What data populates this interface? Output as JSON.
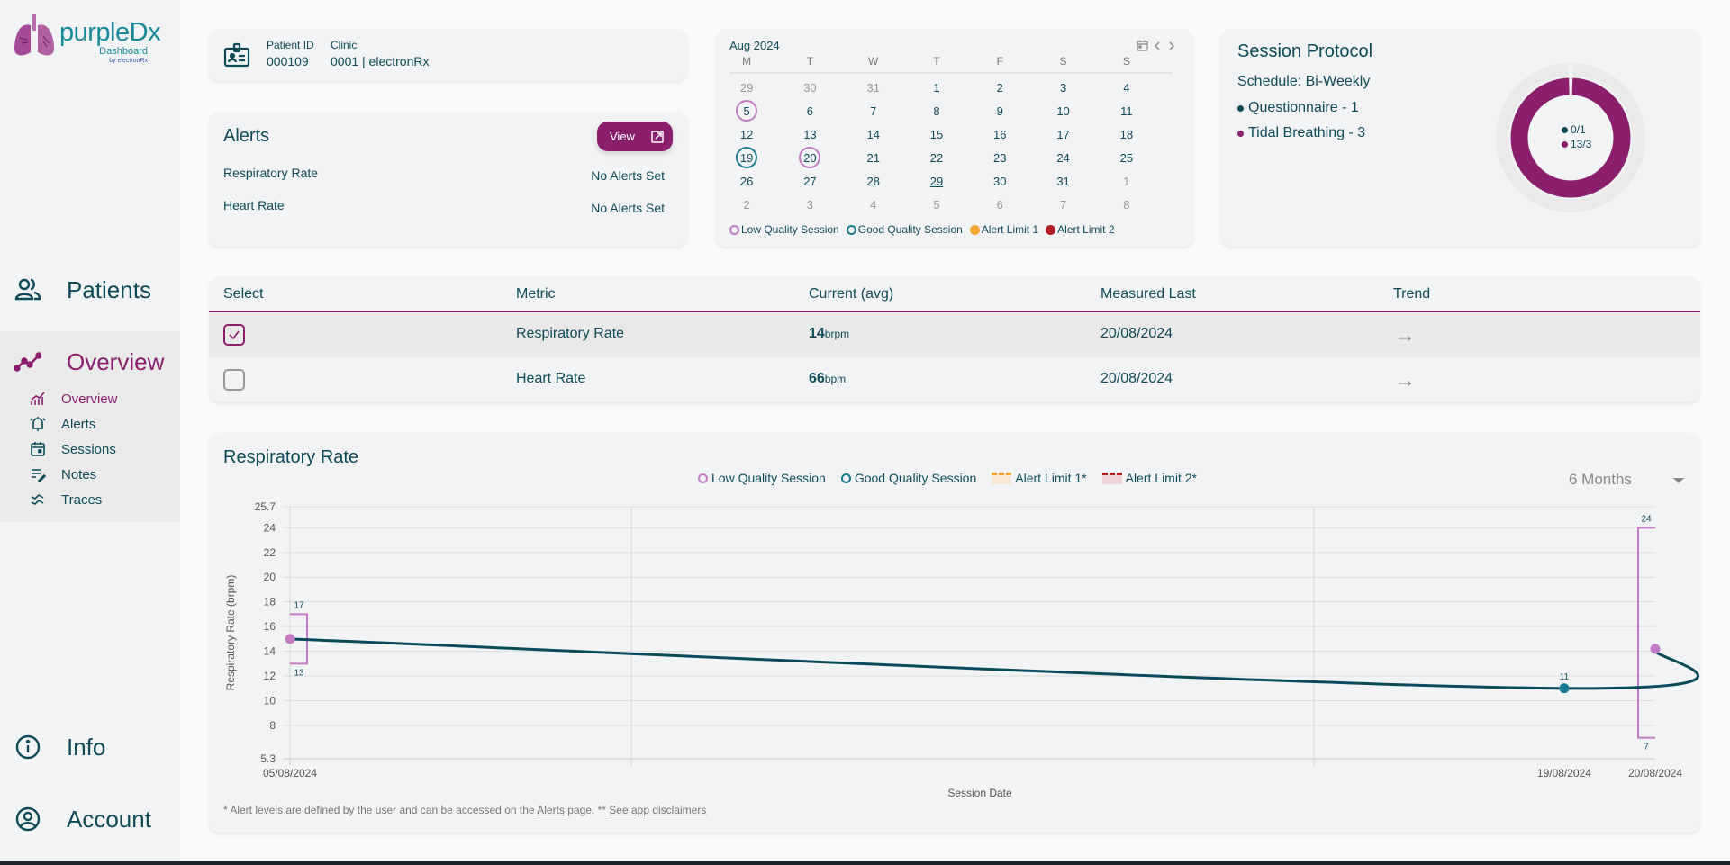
{
  "app": {
    "brand_a": "purple",
    "brand_b": "Dx",
    "subtitle": "Dashboard",
    "byline": "by electronRx"
  },
  "colors": {
    "primary": "#8b1f6e",
    "text": "#0f4a58",
    "low_quality": "#c27bc5",
    "good_quality": "#1a7a8f",
    "alert_limit_1": "#f5a637",
    "alert_limit_2": "#b01e28"
  },
  "sidebar": {
    "patients": {
      "label": "Patients",
      "icon": "people-icon"
    },
    "overview": {
      "label": "Overview",
      "icon": "trend-line-icon"
    },
    "subitems": [
      {
        "label": "Overview",
        "icon": "chart-icon",
        "active": true
      },
      {
        "label": "Alerts",
        "icon": "alarm-bell-icon",
        "active": false
      },
      {
        "label": "Sessions",
        "icon": "calendar-icon",
        "active": false
      },
      {
        "label": "Notes",
        "icon": "notes-edit-icon",
        "active": false
      },
      {
        "label": "Traces",
        "icon": "waves-icon",
        "active": false
      }
    ],
    "info": {
      "label": "Info",
      "icon": "info-icon"
    },
    "account": {
      "label": "Account",
      "icon": "account-icon"
    }
  },
  "patient": {
    "id_label": "Patient ID",
    "id_value": "000109",
    "clinic_label": "Clinic",
    "clinic_value": "0001 | electronRx"
  },
  "alerts": {
    "title": "Alerts",
    "view_label": "View",
    "rows": [
      {
        "metric": "Respiratory Rate",
        "value": "No Alerts Set"
      },
      {
        "metric": "Heart Rate",
        "value": "No Alerts Set"
      }
    ]
  },
  "calendar": {
    "title": "Aug 2024",
    "weekdays": [
      "M",
      "T",
      "W",
      "T",
      "F",
      "S",
      "S"
    ],
    "days": [
      {
        "d": "29",
        "m": true
      },
      {
        "d": "30",
        "m": true
      },
      {
        "d": "31",
        "m": true
      },
      {
        "d": "1"
      },
      {
        "d": "2"
      },
      {
        "d": "3"
      },
      {
        "d": "4"
      },
      {
        "d": "5",
        "s": "low"
      },
      {
        "d": "6"
      },
      {
        "d": "7"
      },
      {
        "d": "8"
      },
      {
        "d": "9"
      },
      {
        "d": "10"
      },
      {
        "d": "11"
      },
      {
        "d": "12"
      },
      {
        "d": "13"
      },
      {
        "d": "14"
      },
      {
        "d": "15"
      },
      {
        "d": "16"
      },
      {
        "d": "17"
      },
      {
        "d": "18"
      },
      {
        "d": "19",
        "s": "good"
      },
      {
        "d": "20",
        "s": "low"
      },
      {
        "d": "21"
      },
      {
        "d": "22"
      },
      {
        "d": "23"
      },
      {
        "d": "24"
      },
      {
        "d": "25"
      },
      {
        "d": "26"
      },
      {
        "d": "27"
      },
      {
        "d": "28"
      },
      {
        "d": "29",
        "today": true
      },
      {
        "d": "30"
      },
      {
        "d": "31"
      },
      {
        "d": "1",
        "m": true
      },
      {
        "d": "2",
        "m": true
      },
      {
        "d": "3",
        "m": true
      },
      {
        "d": "4",
        "m": true
      },
      {
        "d": "5",
        "m": true
      },
      {
        "d": "6",
        "m": true
      },
      {
        "d": "7",
        "m": true
      },
      {
        "d": "8",
        "m": true
      }
    ],
    "legend": [
      "Low Quality Session",
      "Good Quality Session",
      "Alert Limit 1",
      "Alert Limit 2"
    ]
  },
  "protocol": {
    "title": "Session Protocol",
    "schedule": "Schedule: Bi-Weekly",
    "items": [
      {
        "label": "Questionnaire - 1",
        "color": "#0f4a58"
      },
      {
        "label": "Tidal Breathing - 3",
        "color": "#8b1f6e"
      }
    ],
    "donut": [
      {
        "label": "0/1",
        "completed": 0,
        "target": 1,
        "color": "#0f4a58"
      },
      {
        "label": "13/3",
        "completed": 13,
        "target": 3,
        "color": "#8b1f6e"
      }
    ]
  },
  "metrics_table": {
    "headers": [
      "Select",
      "Metric",
      "Current (avg)",
      "Measured Last",
      "Trend"
    ],
    "rows": [
      {
        "selected": true,
        "metric": "Respiratory Rate",
        "value": "14",
        "unit": "brpm",
        "measured": "20/08/2024",
        "trend": "→"
      },
      {
        "selected": false,
        "metric": "Heart Rate",
        "value": "66",
        "unit": "bpm",
        "measured": "20/08/2024",
        "trend": "→"
      }
    ]
  },
  "chart": {
    "title": "Respiratory Rate",
    "legend": [
      "Low Quality Session",
      "Good Quality Session",
      "Alert Limit 1*",
      "Alert Limit 2*"
    ],
    "range_select": "6 Months",
    "footnote_pre": "* Alert levels are defined by the user and can be accessed on the ",
    "footnote_link1": "Alerts",
    "footnote_mid": " page. ** ",
    "footnote_link2": "See app disclaimers"
  },
  "chart_data": {
    "type": "line",
    "title": "Respiratory Rate",
    "xlabel": "Session Date",
    "ylabel": "Respiratory Rate (brpm)",
    "ylim": [
      5.3,
      25.7
    ],
    "yticks": [
      "5.3",
      "8",
      "10",
      "12",
      "14",
      "16",
      "18",
      "20",
      "22",
      "24",
      "25.7"
    ],
    "x": [
      "05/08/2024",
      "19/08/2024",
      "20/08/2024"
    ],
    "x_days": [
      5,
      19,
      20
    ],
    "series": [
      {
        "name": "Respiratory Rate",
        "values": [
          15,
          11,
          14.2
        ],
        "quality": [
          "low",
          "good",
          "low"
        ]
      }
    ],
    "ranges": [
      {
        "x": "05/08/2024",
        "min": 13,
        "max": 17
      },
      {
        "x": "20/08/2024",
        "min": 7,
        "max": 24
      }
    ],
    "point_labels": [
      {
        "x": "19/08/2024",
        "label": "11"
      }
    ],
    "grid": true
  }
}
